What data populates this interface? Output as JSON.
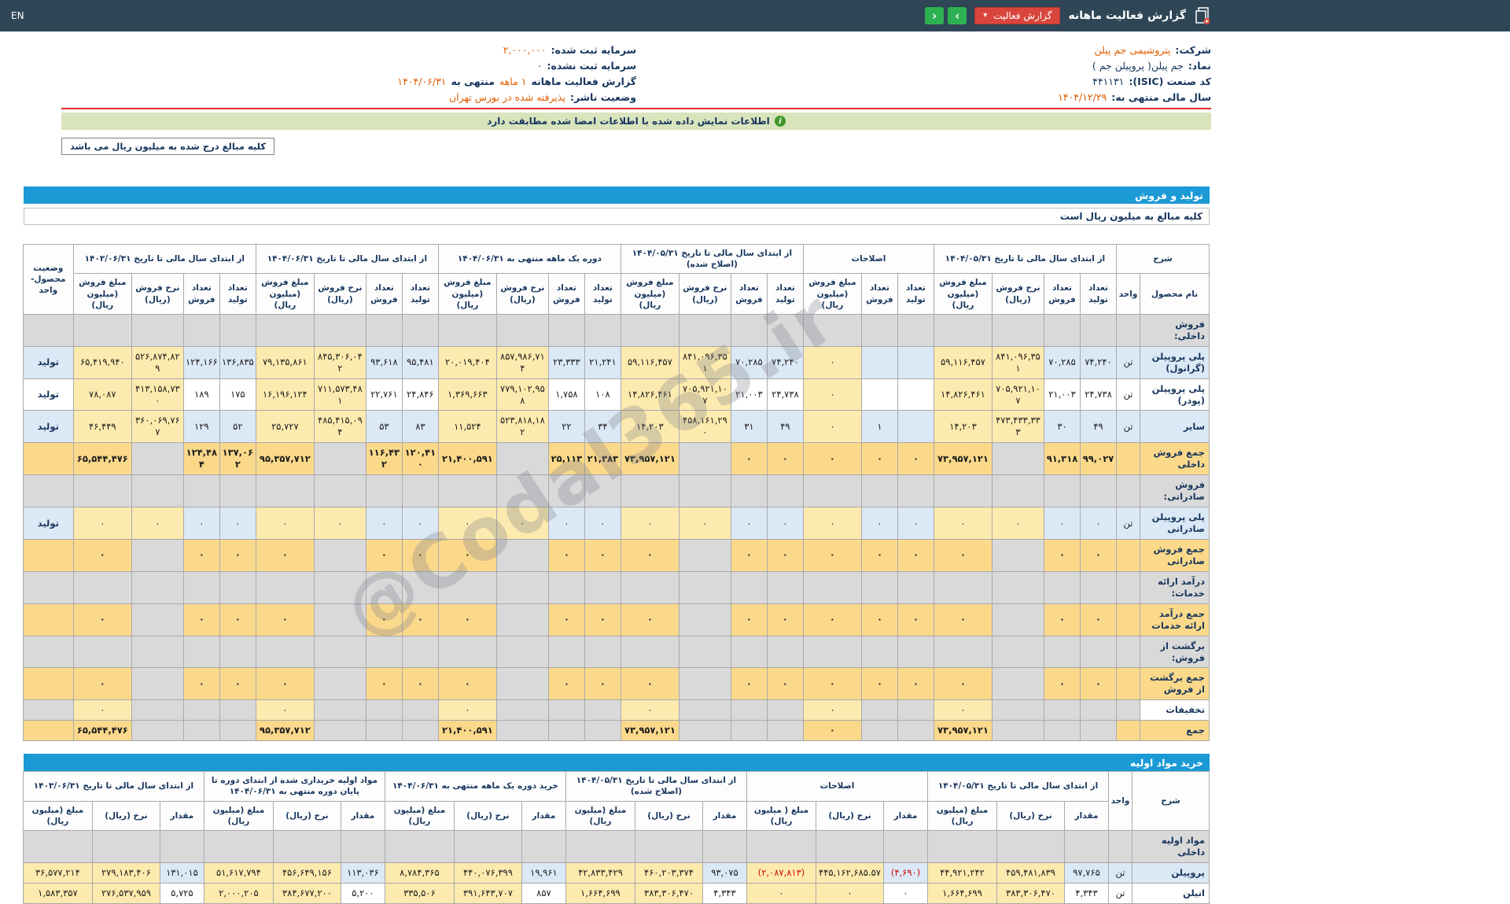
{
  "topbar": {
    "title": "گزارش فعالیت ماهانه",
    "report_button": "گزارش فعالیت",
    "caret": "▾",
    "next": "›",
    "prev": "‹",
    "lang": "EN"
  },
  "info": {
    "right": [
      {
        "label": "شرکت:",
        "value": "پتروشیمی جم پیلن",
        "hl": true
      },
      {
        "label": "نماد:",
        "value": "جم پیلن( پروپیلن جم )",
        "hl": false
      },
      {
        "label": "کد صنعت (ISIC):",
        "value": "۴۴۱۱۳۱",
        "hl": false
      },
      {
        "label": "سال مالی منتهی به:",
        "value": "۱۴۰۴/۱۲/۲۹",
        "hl": true
      }
    ],
    "left": [
      {
        "label": "سرمایه ثبت شده:",
        "value": "۲,۰۰۰,۰۰۰",
        "hl": true
      },
      {
        "label": "سرمایه ثبت نشده:",
        "value": "۰",
        "hl": false
      },
      {
        "label": "گزارش فعالیت ماهانه",
        "value": "۱ ماهه",
        "hl": true,
        "tail": "منتهی به",
        "tail2": "۱۴۰۴/۰۶/۳۱"
      },
      {
        "label": "وضعیت ناشر:",
        "value": "پذیرفته شده در بورس تهران",
        "hl": true
      }
    ]
  },
  "banner": {
    "text": "اطلاعات نمایش داده شده با اطلاعات امضا شده مطابقت دارد"
  },
  "note_box": "کلیه مبالغ درج شده به میلیون ریال می باشد",
  "watermark": "@Codal365.ir",
  "production": {
    "section_title": "تولید و فروش",
    "note": "کلیه مبالغ به میلیون ریال است",
    "desc_header": "شرح",
    "name_header": "نام محصول",
    "unit_header": "واحد",
    "status_header": "وضعیت محصول-واحد",
    "groups": [
      {
        "label": "از ابتدای سال مالی تا تاریخ ۱۴۰۴/۰۵/۳۱",
        "cols": [
          {
            "label": "تعداد تولید",
            "kind": "qty"
          },
          {
            "label": "تعداد فروش",
            "kind": "qty"
          },
          {
            "label": "نرخ فروش (ریال)",
            "kind": "rate"
          },
          {
            "label": "مبلغ فروش (میلیون ریال)",
            "kind": "amt"
          }
        ]
      },
      {
        "label": "اصلاحات",
        "cols": [
          {
            "label": "تعداد تولید",
            "kind": "qty"
          },
          {
            "label": "تعداد فروش",
            "kind": "qty"
          },
          {
            "label": "مبلغ فروش (میلیون ریال)",
            "kind": "amt"
          }
        ]
      },
      {
        "label": "از ابتدای سال مالی تا تاریخ ۱۴۰۴/۰۵/۳۱ (اصلاح شده)",
        "cols": [
          {
            "label": "تعداد تولید",
            "kind": "qty"
          },
          {
            "label": "تعداد فروش",
            "kind": "qty"
          },
          {
            "label": "نرخ فروش (ریال)",
            "kind": "rate"
          },
          {
            "label": "مبلغ فروش (میلیون ریال)",
            "kind": "amt"
          }
        ]
      },
      {
        "label": "دوره یک ماهه منتهی به ۱۴۰۴/۰۶/۳۱",
        "cols": [
          {
            "label": "تعداد تولید",
            "kind": "qty"
          },
          {
            "label": "تعداد فروش",
            "kind": "qty"
          },
          {
            "label": "نرخ فروش (ریال)",
            "kind": "rate"
          },
          {
            "label": "مبلغ فروش (میلیون ریال)",
            "kind": "amt"
          }
        ]
      },
      {
        "label": "از ابتدای سال مالی تا تاریخ ۱۴۰۴/۰۶/۳۱",
        "cols": [
          {
            "label": "تعداد تولید",
            "kind": "qty"
          },
          {
            "label": "تعداد فروش",
            "kind": "qty"
          },
          {
            "label": "نرخ فروش (ریال)",
            "kind": "rate"
          },
          {
            "label": "مبلغ فروش (میلیون ریال)",
            "kind": "amt"
          }
        ]
      },
      {
        "label": "از ابتدای سال مالی تا تاریخ ۱۴۰۳/۰۶/۳۱",
        "cols": [
          {
            "label": "تعداد تولید",
            "kind": "qty"
          },
          {
            "label": "تعداد فروش",
            "kind": "qty"
          },
          {
            "label": "نرخ فروش (ریال)",
            "kind": "rate"
          },
          {
            "label": "مبلغ فروش (میلیون ریال)",
            "kind": "amt"
          }
        ]
      }
    ],
    "rows": [
      {
        "t": "group",
        "name": "فروش داخلی:"
      },
      {
        "t": "data",
        "name": "پلی پروپیلن (گرانول)",
        "unit": "تن",
        "status": "تولید",
        "alt": true,
        "c": [
          "۷۴,۲۴۰",
          "۷۰,۲۸۵",
          "۸۴۱,۰۹۶,۳۵۱",
          "۵۹,۱۱۶,۴۵۷",
          "",
          "",
          "۰",
          "۷۴,۲۴۰",
          "۷۰,۲۸۵",
          "۸۴۱,۰۹۶,۳۵۱",
          "۵۹,۱۱۶,۴۵۷",
          "۲۱,۲۴۱",
          "۲۳,۳۳۳",
          "۸۵۷,۹۸۶,۷۱۴",
          "۲۰,۰۱۹,۴۰۴",
          "۹۵,۴۸۱",
          "۹۳,۶۱۸",
          "۸۴۵,۳۰۶,۰۴۲",
          "۷۹,۱۳۵,۸۶۱",
          "۱۳۶,۸۳۵",
          "۱۲۴,۱۶۶",
          "۵۲۶,۸۷۴,۸۲۹",
          "۶۵,۴۱۹,۹۴۰"
        ]
      },
      {
        "t": "data",
        "name": "پلی پروپیلن (پودر)",
        "unit": "تن",
        "status": "تولید",
        "alt": false,
        "c": [
          "۲۴,۷۳۸",
          "۲۱,۰۰۳",
          "۷۰۵,۹۲۱,۱۰۷",
          "۱۴,۸۲۶,۴۶۱",
          "",
          "",
          "۰",
          "۲۴,۷۳۸",
          "۲۱,۰۰۳",
          "۷۰۵,۹۲۱,۱۰۷",
          "۱۴,۸۲۶,۴۶۱",
          "۱۰۸",
          "۱,۷۵۸",
          "۷۷۹,۱۰۲,۹۵۸",
          "۱,۳۶۹,۶۶۳",
          "۲۴,۸۴۶",
          "۲۲,۷۶۱",
          "۷۱۱,۵۷۳,۴۸۱",
          "۱۶,۱۹۶,۱۲۴",
          "۱۷۵",
          "۱۸۹",
          "۴۱۳,۱۵۸,۷۳۰",
          "۷۸,۰۸۷"
        ]
      },
      {
        "t": "data",
        "name": "سایر",
        "unit": "تن",
        "status": "تولید",
        "alt": true,
        "c": [
          "۴۹",
          "۳۰",
          "۴۷۳,۴۳۳,۳۳۳",
          "۱۴,۲۰۳",
          "",
          "۱",
          "۰",
          "۴۹",
          "۳۱",
          "۴۵۸,۱۶۱,۲۹۰",
          "۱۴,۲۰۳",
          "۳۴",
          "۲۲",
          "۵۲۳,۸۱۸,۱۸۲",
          "۱۱,۵۲۴",
          "۸۳",
          "۵۳",
          "۴۸۵,۴۱۵,۰۹۴",
          "۲۵,۷۲۷",
          "۵۲",
          "۱۲۹",
          "۳۶۰,۰۶۹,۷۶۷",
          "۴۶,۴۴۹"
        ]
      },
      {
        "t": "total",
        "name": "جمع فروش داخلی",
        "c": [
          "۹۹,۰۲۷",
          "۹۱,۳۱۸",
          null,
          "۷۳,۹۵۷,۱۲۱",
          "۰",
          "۰",
          "۰",
          "۰",
          "۰",
          null,
          "۷۳,۹۵۷,۱۲۱",
          "۲۱,۳۸۳",
          "۲۵,۱۱۳",
          null,
          "۲۱,۴۰۰,۵۹۱",
          "۱۲۰,۴۱۰",
          "۱۱۶,۴۳۲",
          null,
          "۹۵,۳۵۷,۷۱۲",
          "۱۳۷,۰۶۲",
          "۱۲۴,۴۸۴",
          null,
          "۶۵,۵۴۴,۴۷۶"
        ]
      },
      {
        "t": "group",
        "name": "فروش صادراتی:"
      },
      {
        "t": "data",
        "name": "پلی پروپیلن صادراتی",
        "unit": "تن",
        "status": "تولید",
        "alt": true,
        "c": [
          "۰",
          "۰",
          "۰",
          "۰",
          "۰",
          "۰",
          "۰",
          "۰",
          "۰",
          "۰",
          "۰",
          "۰",
          "۰",
          "۰",
          "۰",
          "۰",
          "۰",
          "۰",
          "۰",
          "۰",
          "۰",
          "۰",
          "۰"
        ]
      },
      {
        "t": "total",
        "name": "جمع فروش صادراتی",
        "c": [
          "۰",
          "۰",
          null,
          "۰",
          "۰",
          "۰",
          "۰",
          "۰",
          "۰",
          null,
          "۰",
          "۰",
          "۰",
          null,
          "۰",
          "۰",
          "۰",
          null,
          "۰",
          "۰",
          "۰",
          null,
          "۰"
        ]
      },
      {
        "t": "group",
        "name": "درآمد ارائه خدمات:"
      },
      {
        "t": "total",
        "name": "جمع درآمد ارائه خدمات",
        "c": [
          "۰",
          "۰",
          null,
          "۰",
          "۰",
          "۰",
          "۰",
          "۰",
          "۰",
          null,
          "۰",
          "۰",
          "۰",
          null,
          "۰",
          "۰",
          "۰",
          null,
          "۰",
          "۰",
          "۰",
          null,
          "۰"
        ]
      },
      {
        "t": "group",
        "name": "برگشت از فروش:"
      },
      {
        "t": "total",
        "name": "جمع برگشت از فروش",
        "c": [
          "۰",
          "۰",
          null,
          "۰",
          "۰",
          "۰",
          "۰",
          "۰",
          "۰",
          null,
          "۰",
          "۰",
          "۰",
          null,
          "۰",
          "۰",
          "۰",
          null,
          "۰",
          "۰",
          "۰",
          null,
          "۰"
        ]
      },
      {
        "t": "plain",
        "name": "تخفیفات",
        "c": [
          null,
          null,
          null,
          "۰",
          null,
          null,
          "۰",
          null,
          null,
          null,
          "۰",
          null,
          null,
          null,
          "۰",
          null,
          null,
          null,
          "۰",
          null,
          null,
          null,
          "۰"
        ]
      },
      {
        "t": "total",
        "name": "جمع",
        "c": [
          null,
          null,
          null,
          "۷۳,۹۵۷,۱۲۱",
          null,
          null,
          "۰",
          null,
          null,
          null,
          "۷۳,۹۵۷,۱۲۱",
          null,
          null,
          null,
          "۲۱,۴۰۰,۵۹۱",
          null,
          null,
          null,
          "۹۵,۳۵۷,۷۱۲",
          null,
          null,
          null,
          "۶۵,۵۴۴,۴۷۶"
        ]
      }
    ]
  },
  "materials": {
    "section_title": "خرید مواد اولیه",
    "desc_header": "شرح",
    "unit_header": "واحد",
    "groups": [
      {
        "label": "از ابتدای سال مالی تا تاریخ ۱۴۰۴/۰۵/۳۱",
        "cols": [
          {
            "label": "مقدار",
            "kind": "qty"
          },
          {
            "label": "نرخ (ریال)",
            "kind": "rate"
          },
          {
            "label": "مبلغ (میلیون ریال)",
            "kind": "amt"
          }
        ]
      },
      {
        "label": "اصلاحات",
        "cols": [
          {
            "label": "مقدار",
            "kind": "qty"
          },
          {
            "label": "نرخ (ریال)",
            "kind": "rate"
          },
          {
            "label": "مبلغ ( میلیون ریال)",
            "kind": "amt"
          }
        ]
      },
      {
        "label": "از ابتدای سال مالی تا تاریخ ۱۴۰۴/۰۵/۳۱ (اصلاح شده)",
        "cols": [
          {
            "label": "مقدار",
            "kind": "qty"
          },
          {
            "label": "نرخ (ریال)",
            "kind": "rate"
          },
          {
            "label": "مبلغ (میلیون ریال)",
            "kind": "amt"
          }
        ]
      },
      {
        "label": "خرید دوره یک ماهه منتهی به ۱۴۰۴/۰۶/۳۱",
        "cols": [
          {
            "label": "مقدار",
            "kind": "qty"
          },
          {
            "label": "نرخ (ریال)",
            "kind": "rate"
          },
          {
            "label": "مبلغ (میلیون ریال)",
            "kind": "amt"
          }
        ]
      },
      {
        "label": "مواد اولیه خریداری شده از ابتدای دوره تا پایان دوره منتهی به ۱۴۰۴/۰۶/۳۱",
        "cols": [
          {
            "label": "مقدار",
            "kind": "qty"
          },
          {
            "label": "نرخ (ریال)",
            "kind": "rate"
          },
          {
            "label": "مبلغ (میلیون ریال)",
            "kind": "amt"
          }
        ]
      },
      {
        "label": "از ابتدای سال مالی تا تاریخ ۱۴۰۳/۰۶/۳۱",
        "cols": [
          {
            "label": "مقدار",
            "kind": "qty"
          },
          {
            "label": "نرخ (ریال)",
            "kind": "rate"
          },
          {
            "label": "مبلغ (میلیون ریال)",
            "kind": "amt"
          }
        ]
      }
    ],
    "rows": [
      {
        "t": "group",
        "name": "مواد اولیه داخلی"
      },
      {
        "t": "data",
        "name": "پروپیلن",
        "unit": "تن",
        "alt": true,
        "c": [
          "۹۷,۷۶۵",
          "۴۵۹,۴۸۱,۸۳۹",
          "۴۴,۹۲۱,۲۴۲",
          "(۴,۶۹۰)",
          "۴۴۵,۱۶۲,۶۸۵.۵۷",
          "(۲,۰۸۷,۸۱۳)",
          "۹۳,۰۷۵",
          "۴۶۰,۲۰۳,۳۷۴",
          "۴۲,۸۳۳,۴۲۹",
          "۱۹,۹۶۱",
          "۴۴۰,۰۷۶,۳۹۹",
          "۸,۷۸۴,۳۶۵",
          "۱۱۳,۰۳۶",
          "۴۵۶,۶۴۹,۱۵۶",
          "۵۱,۶۱۷,۷۹۴",
          "۱۳۱,۰۱۵",
          "۲۷۹,۱۸۳,۴۰۶",
          "۳۶,۵۷۷,۲۱۴"
        ]
      },
      {
        "t": "data",
        "name": "اتیلن",
        "unit": "تن",
        "alt": false,
        "c": [
          "۴,۳۴۳",
          "۳۸۳,۳۰۶,۴۷۰",
          "۱,۶۶۴,۶۹۹",
          "۰",
          "۰",
          "۰",
          "۴,۳۴۳",
          "۳۸۳,۳۰۶,۴۷۰",
          "۱,۶۶۴,۶۹۹",
          "۸۵۷",
          "۳۹۱,۶۴۳,۷۰۷",
          "۳۳۵,۵۰۶",
          "۵,۲۰۰",
          "۳۸۴,۶۷۷,۲۰۰",
          "۲,۰۰۰,۲۰۵",
          "۵,۷۲۵",
          "۲۷۶,۵۳۷,۹۵۹",
          "۱,۵۸۳,۳۵۷"
        ]
      }
    ]
  }
}
